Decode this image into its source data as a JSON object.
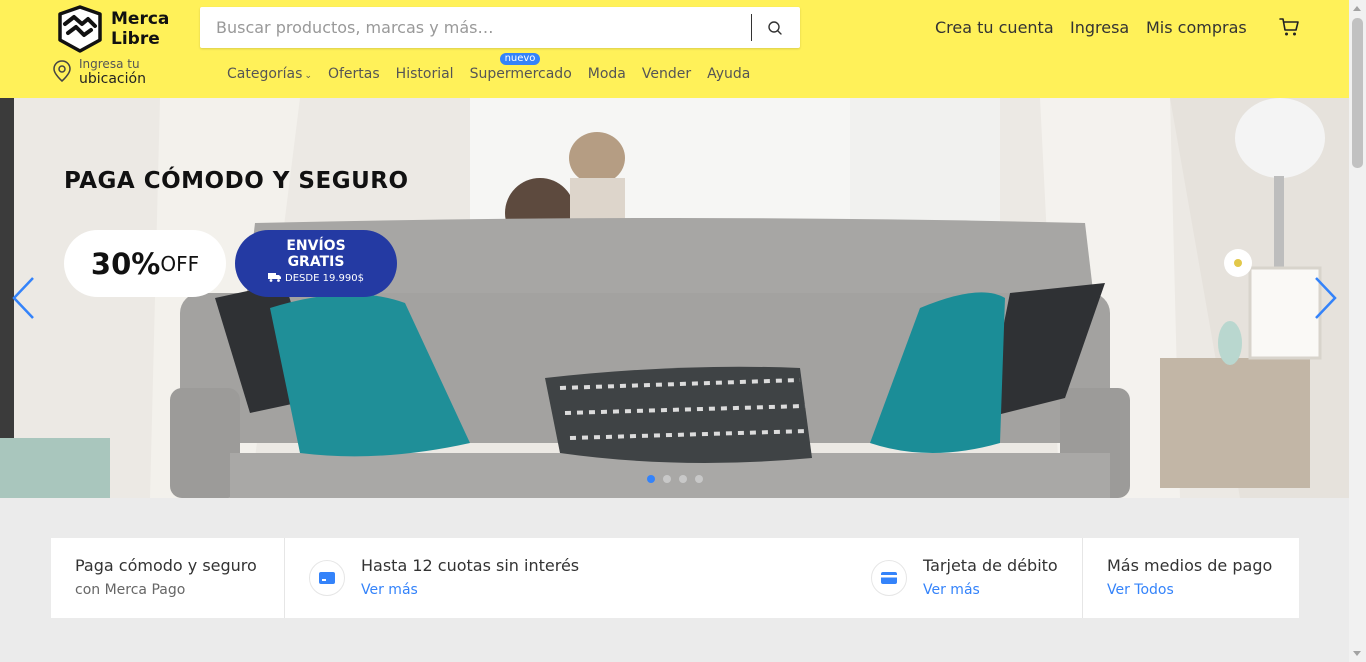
{
  "colors": {
    "header_bg": "#fff159",
    "accent": "#3483fa",
    "envios_bg": "#243aa3"
  },
  "logo": {
    "line1": "Merca",
    "line2": "Libre",
    "icon": "handshake-logo-icon"
  },
  "location": {
    "small": "Ingresa tu",
    "big": "ubicación",
    "icon": "location-pin-icon"
  },
  "search": {
    "placeholder": "Buscar productos, marcas y más…",
    "icon": "search-icon"
  },
  "nav": {
    "categorias": "Categorías",
    "ofertas": "Ofertas",
    "historial": "Historial",
    "supermercado": "Supermercado",
    "badge": "nuevo",
    "moda": "Moda",
    "vender": "Vender",
    "ayuda": "Ayuda"
  },
  "account": {
    "crear": "Crea tu cuenta",
    "ingresa": "Ingresa",
    "compras": "Mis compras",
    "cart_icon": "cart-icon"
  },
  "hero": {
    "title": "PAGA CÓMODO Y SEGURO",
    "off_value": "30%",
    "off_label": "OFF",
    "envios_line1": "ENVÍOS",
    "envios_line2": "GRATIS",
    "envios_sub": "DESDE 19.990$",
    "slide_count": 4,
    "active_slide": 1
  },
  "payments": {
    "col1_title": "Paga cómodo y seguro",
    "col1_sub": "con Merca Pago",
    "col2_title": "Hasta 12 cuotas sin interés",
    "col2_link": "Ver más",
    "col3_title": "Tarjeta de débito",
    "col3_link": "Ver más",
    "col4_title": "Más medios de pago",
    "col4_link": "Ver Todos"
  }
}
